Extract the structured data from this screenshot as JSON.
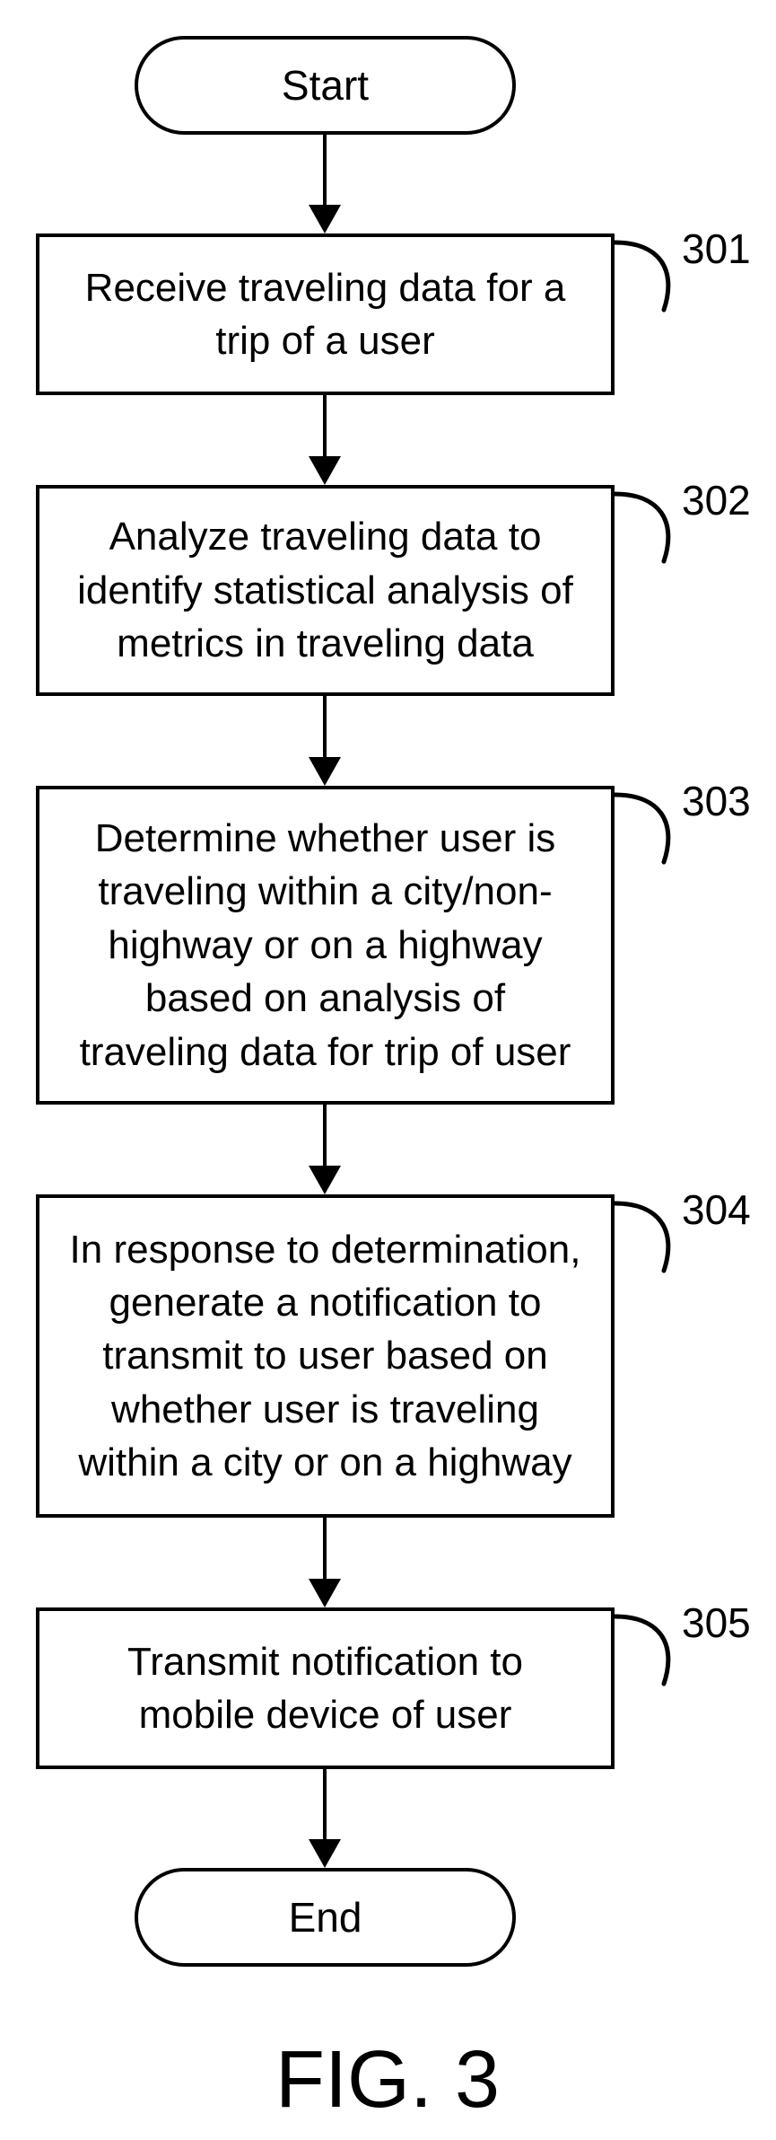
{
  "terminators": {
    "start": "Start",
    "end": "End"
  },
  "steps": {
    "s301": "Receive traveling data for a trip of a user",
    "s302": "Analyze traveling data to identify statistical analysis of metrics in traveling data",
    "s303": "Determine whether user is traveling within a city/non-highway or on a highway based on analysis of traveling data for trip of user",
    "s304": "In response to determination, generate a notification to transmit to user based on whether user is traveling within a city or on a highway",
    "s305": "Transmit notification to mobile device of user"
  },
  "refs": {
    "r301": "301",
    "r302": "302",
    "r303": "303",
    "r304": "304",
    "r305": "305"
  },
  "figure_label": "FIG. 3"
}
